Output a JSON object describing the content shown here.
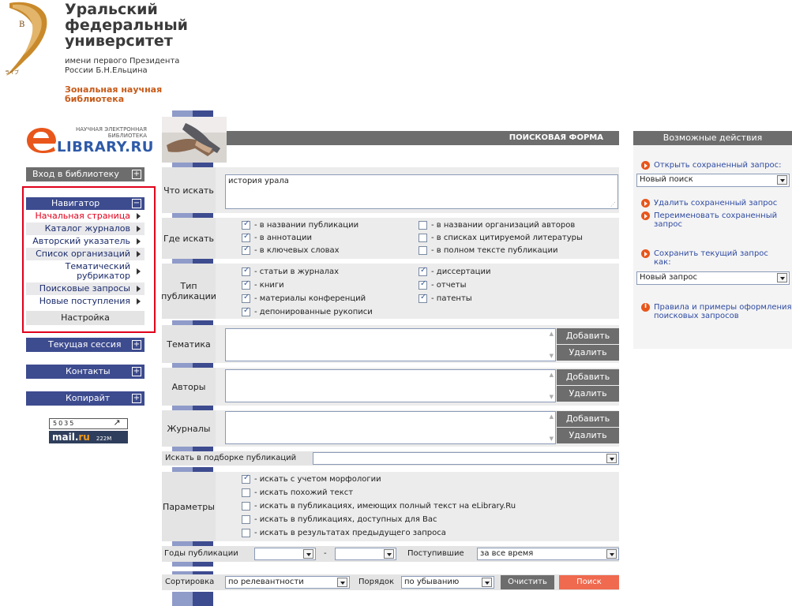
{
  "university": {
    "title_line1": "Уральский",
    "title_line2": "федеральный",
    "title_line3": "университет",
    "sub_line1": "имени первого Президента",
    "sub_line2": "России Б.Н.Ельцина",
    "lib_line1": "Зональная научная",
    "lib_line2": "библиотека"
  },
  "elibrary": {
    "small_line1": "НАУЧНАЯ ЭЛЕКТРОННАЯ",
    "small_line2": "БИБЛИОТЕКА",
    "name": "LIBRARY.RU"
  },
  "left": {
    "login": "Вход в библиотеку",
    "navigator": "Навигатор",
    "nav_items": [
      "Начальная страница",
      "Каталог журналов",
      "Авторский указатель",
      "Список организаций",
      "Тематический",
      "рубрикатор",
      "Поисковые запросы",
      "Новые поступления"
    ],
    "settings": "Настройка",
    "session": "Текущая сессия",
    "contacts": "Контакты",
    "copyright": "Копирайт",
    "counter_value": "5035",
    "counter_brand_a": "mail.",
    "counter_brand_b": "ru",
    "counter_num": "222M"
  },
  "form": {
    "header": "ПОИСКОВАЯ ФОРМА",
    "what_label": "Что искать",
    "query": "история урала",
    "where_label": "Где искать",
    "where": [
      {
        "label": "- в названии публикации",
        "checked": true
      },
      {
        "label": "- в аннотации",
        "checked": true
      },
      {
        "label": "- в ключевых словах",
        "checked": true
      },
      {
        "label": "- в названии организаций авторов",
        "checked": false
      },
      {
        "label": "- в списках цитируемой литературы",
        "checked": false
      },
      {
        "label": "- в полном тексте публикации",
        "checked": false
      }
    ],
    "type_label1": "Тип",
    "type_label2": "публикации",
    "types": [
      {
        "label": "- статьи в журналах",
        "checked": true
      },
      {
        "label": "- книги",
        "checked": true
      },
      {
        "label": "- материалы конференций",
        "checked": true
      },
      {
        "label": "- депонированные рукописи",
        "checked": true
      },
      {
        "label": "- диссертации",
        "checked": true
      },
      {
        "label": "- отчеты",
        "checked": true
      },
      {
        "label": "- патенты",
        "checked": true
      }
    ],
    "topic_label": "Тематика",
    "authors_label": "Авторы",
    "journals_label": "Журналы",
    "add": "Добавить",
    "remove": "Удалить",
    "collection_label": "Искать в подборке публикаций",
    "params_label": "Параметры",
    "params": [
      {
        "label": "- искать с учетом морфологии",
        "checked": true
      },
      {
        "label": "- искать похожий текст",
        "checked": false
      },
      {
        "label": "- искать в публикациях, имеющих полный текст на eLibrary.Ru",
        "checked": false
      },
      {
        "label": "- искать в публикациях, доступных для Вас",
        "checked": false
      },
      {
        "label": "- искать в результатах предыдущего запроса",
        "checked": false
      }
    ],
    "years_label": "Годы публикации",
    "dash": "-",
    "arrived_label": "Поступившие",
    "arrived_value": "за все время",
    "sort_label": "Сортировка",
    "sort_value": "по релевантности",
    "order_label": "Порядок",
    "order_value": "по убыванию",
    "clear": "Очистить",
    "search": "Поиск"
  },
  "right": {
    "header": "Возможные действия",
    "open_saved": "Открыть сохраненный запрос:",
    "open_select": "Новый поиск",
    "delete_saved": "Удалить сохраненный запрос",
    "rename_saved1": "Переименовать сохраненный",
    "rename_saved2": "запрос",
    "save_current1": "Сохранить текущий запрос",
    "save_current2": "как:",
    "save_select": "Новый запрос",
    "rules1": "Правила и примеры оформления",
    "rules2": "поисковых запросов"
  },
  "colors": {
    "nav_blue": "#3d4b8f",
    "header_grey": "#6d6d6d",
    "accent_red": "#e0001b",
    "accent_orange": "#e8561b",
    "search_button": "#ef6a4f"
  }
}
